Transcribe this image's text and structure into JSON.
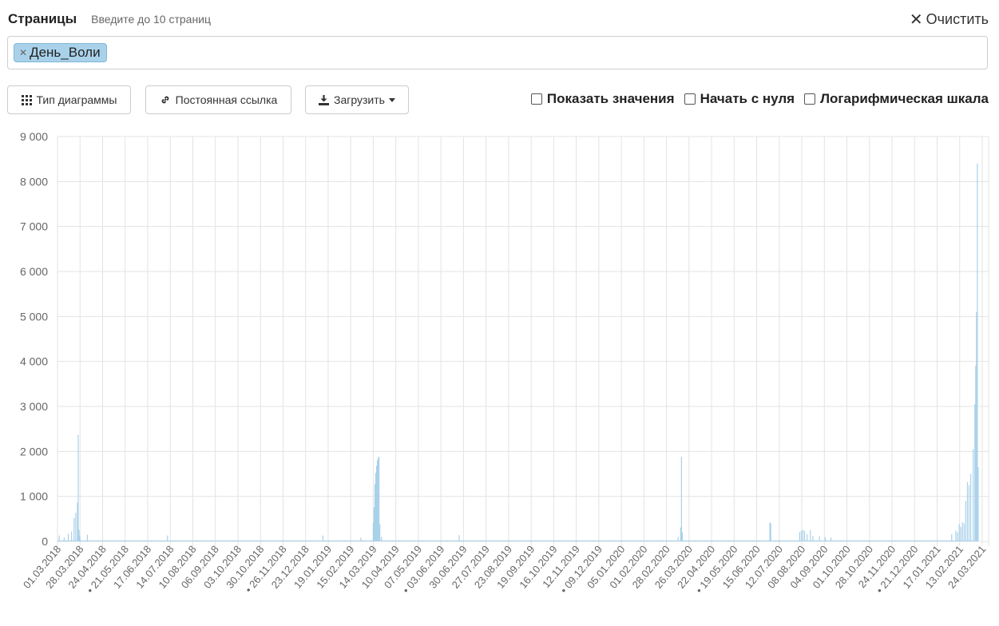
{
  "header": {
    "title": "Страницы",
    "hint": "Введите до 10 страниц",
    "clear_label": "Очистить"
  },
  "pages": [
    {
      "label": "День_Воли"
    }
  ],
  "toolbar": {
    "chart_type_label": "Тип диаграммы",
    "permalink_label": "Постоянная ссылка",
    "download_label": "Загрузить"
  },
  "options": {
    "show_values": {
      "label": "Показать значения",
      "checked": false
    },
    "begin_at_zero": {
      "label": "Начать с нуля",
      "checked": false
    },
    "log_scale": {
      "label": "Логарифмическая шкала",
      "checked": false
    }
  },
  "colors": {
    "bar_fill": "#a8d1ea",
    "grid": "#e3e3e3",
    "accent_tag": "#a9d2ea"
  },
  "chart_data": {
    "type": "bar",
    "ylim": [
      0,
      9000
    ],
    "y_ticks": [
      0,
      1000,
      2000,
      3000,
      4000,
      5000,
      6000,
      7000,
      8000,
      9000
    ],
    "y_tick_labels": [
      "0",
      "1 000",
      "2 000",
      "3 000",
      "4 000",
      "5 000",
      "6 000",
      "7 000",
      "8 000",
      "9 000"
    ],
    "x_tick_labels": [
      "01.03.2018",
      "28.03.2018",
      "24.04.2018",
      "21.05.2018",
      "17.06.2018",
      "14.07.2018",
      "10.08.2018",
      "06.09.2018",
      "03.10.2018",
      "30.10.2018",
      "26.11.2018",
      "23.12.2018",
      "19.01.2019",
      "15.02.2019",
      "14.03.2019",
      "10.04.2019",
      "07.05.2019",
      "03.06.2019",
      "30.06.2019",
      "27.07.2019",
      "23.08.2019",
      "19.09.2019",
      "16.10.2019",
      "12.11.2019",
      "09.12.2019",
      "05.01.2020",
      "01.02.2020",
      "28.02.2020",
      "26.03.2020",
      "22.04.2020",
      "19.05.2020",
      "15.06.2020",
      "12.07.2020",
      "08.08.2020",
      "04.09.2020",
      "01.10.2020",
      "28.10.2020",
      "24.11.2020",
      "21.12.2020",
      "17.01.2021",
      "13.02.2021",
      "24.03.2021"
    ],
    "x_tick_marker": [
      false,
      false,
      false,
      true,
      false,
      false,
      false,
      false,
      false,
      false,
      true,
      false,
      false,
      false,
      false,
      false,
      false,
      true,
      false,
      false,
      false,
      false,
      false,
      false,
      true,
      false,
      false,
      false,
      false,
      false,
      true,
      false,
      false,
      false,
      false,
      false,
      false,
      false,
      true,
      false,
      false,
      false
    ],
    "series": [
      {
        "baseline": 20,
        "spikes": [
          {
            "date": "03.03.2018",
            "value": 130
          },
          {
            "date": "09.03.2018",
            "value": 90
          },
          {
            "date": "14.03.2018",
            "value": 170
          },
          {
            "date": "18.03.2018",
            "value": 220
          },
          {
            "date": "21.03.2018",
            "value": 520
          },
          {
            "date": "23.03.2018",
            "value": 630
          },
          {
            "date": "25.03.2018",
            "value": 860
          },
          {
            "date": "26.03.2018",
            "value": 2370
          },
          {
            "date": "27.03.2018",
            "value": 260
          },
          {
            "date": "28.03.2018",
            "value": 120
          },
          {
            "date": "06.04.2018",
            "value": 150
          },
          {
            "date": "12.07.2018",
            "value": 130
          },
          {
            "date": "16.01.2019",
            "value": 130
          },
          {
            "date": "03.03.2019",
            "value": 80
          },
          {
            "date": "18.03.2019",
            "value": 410
          },
          {
            "date": "19.03.2019",
            "value": 760
          },
          {
            "date": "20.03.2019",
            "value": 1270
          },
          {
            "date": "21.03.2019",
            "value": 1520
          },
          {
            "date": "22.03.2019",
            "value": 1680
          },
          {
            "date": "23.03.2019",
            "value": 1800
          },
          {
            "date": "24.03.2019",
            "value": 1860
          },
          {
            "date": "25.03.2019",
            "value": 1880
          },
          {
            "date": "26.03.2019",
            "value": 380
          },
          {
            "date": "28.03.2019",
            "value": 100
          },
          {
            "date": "30.06.2019",
            "value": 140
          },
          {
            "date": "21.03.2020",
            "value": 100
          },
          {
            "date": "24.03.2020",
            "value": 310
          },
          {
            "date": "25.03.2020",
            "value": 1880
          },
          {
            "date": "26.03.2020",
            "value": 200
          },
          {
            "date": "10.07.2020",
            "value": 420
          },
          {
            "date": "11.07.2020",
            "value": 400
          },
          {
            "date": "15.08.2020",
            "value": 210
          },
          {
            "date": "17.08.2020",
            "value": 240
          },
          {
            "date": "19.08.2020",
            "value": 260
          },
          {
            "date": "21.08.2020",
            "value": 230
          },
          {
            "date": "24.08.2020",
            "value": 160
          },
          {
            "date": "28.08.2020",
            "value": 250
          },
          {
            "date": "31.08.2020",
            "value": 120
          },
          {
            "date": "08.09.2020",
            "value": 110
          },
          {
            "date": "15.09.2020",
            "value": 95
          },
          {
            "date": "22.09.2020",
            "value": 85
          },
          {
            "date": "15.02.2021",
            "value": 160
          },
          {
            "date": "20.02.2021",
            "value": 240
          },
          {
            "date": "22.02.2021",
            "value": 200
          },
          {
            "date": "24.02.2021",
            "value": 380
          },
          {
            "date": "26.02.2021",
            "value": 320
          },
          {
            "date": "28.02.2021",
            "value": 430
          },
          {
            "date": "02.03.2021",
            "value": 400
          },
          {
            "date": "04.03.2021",
            "value": 900
          },
          {
            "date": "06.03.2021",
            "value": 1320
          },
          {
            "date": "08.03.2021",
            "value": 1250
          },
          {
            "date": "10.03.2021",
            "value": 1500
          },
          {
            "date": "13.03.2021",
            "value": 2050
          },
          {
            "date": "15.03.2021",
            "value": 3050
          },
          {
            "date": "16.03.2021",
            "value": 3900
          },
          {
            "date": "17.03.2021",
            "value": 5100
          },
          {
            "date": "18.03.2021",
            "value": 8400
          },
          {
            "date": "19.03.2021",
            "value": 1650
          }
        ]
      }
    ]
  }
}
